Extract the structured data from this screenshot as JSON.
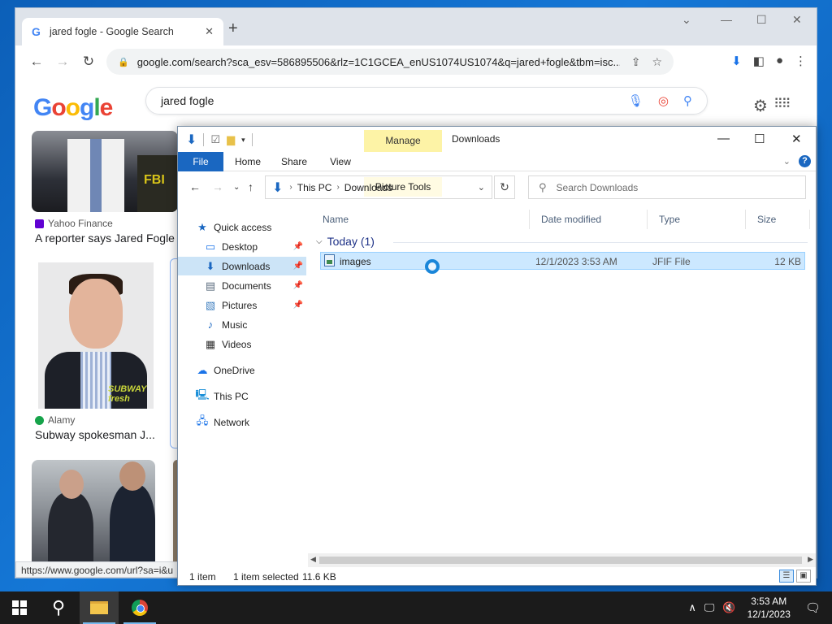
{
  "browser": {
    "tab_title": "jared fogle - Google Search",
    "tab_favicon": "G",
    "url": "google.com/search?sca_esv=586895506&rlz=1C1GCEA_enUS1074US1074&q=jared+fogle&tbm=isc...",
    "status_url": "https://www.google.com/url?sa=i&u"
  },
  "google": {
    "query": "jared fogle",
    "results": [
      {
        "source": "Yahoo Finance",
        "caption": "A reporter says Jared Fogle",
        "source_color": "#6001d2"
      },
      {
        "source": "Alamy",
        "caption": "Subway spokesman J...",
        "source_color": "#16a34a"
      }
    ],
    "thumb_text_1": "FBI",
    "thumb_logo_text": "SUBWAY fresh"
  },
  "explorer": {
    "title": "Downloads",
    "manage_label": "Manage",
    "picture_tools_label": "Picture Tools",
    "ribbon_tabs": [
      "File",
      "Home",
      "Share",
      "View"
    ],
    "breadcrumb": [
      "This PC",
      "Downloads"
    ],
    "search_placeholder": "Search Downloads",
    "nav": {
      "quick_access": "Quick access",
      "desktop": "Desktop",
      "downloads": "Downloads",
      "documents": "Documents",
      "pictures": "Pictures",
      "music": "Music",
      "videos": "Videos",
      "onedrive": "OneDrive",
      "this_pc": "This PC",
      "network": "Network"
    },
    "columns": [
      "Name",
      "Date modified",
      "Type",
      "Size"
    ],
    "group_label": "Today (1)",
    "files": [
      {
        "name": "images",
        "date": "12/1/2023 3:53 AM",
        "type": "JFIF File",
        "size": "12 KB"
      }
    ],
    "status": {
      "count": "1 item",
      "selected": "1 item selected",
      "size": "11.6 KB"
    }
  },
  "taskbar": {
    "time": "3:53 AM",
    "date": "12/1/2023"
  },
  "colors": {
    "accent": "#1a67c1",
    "selection": "#cce8ff",
    "manage_tab": "#fdf3a6",
    "desktop": "#0c5fb8"
  }
}
